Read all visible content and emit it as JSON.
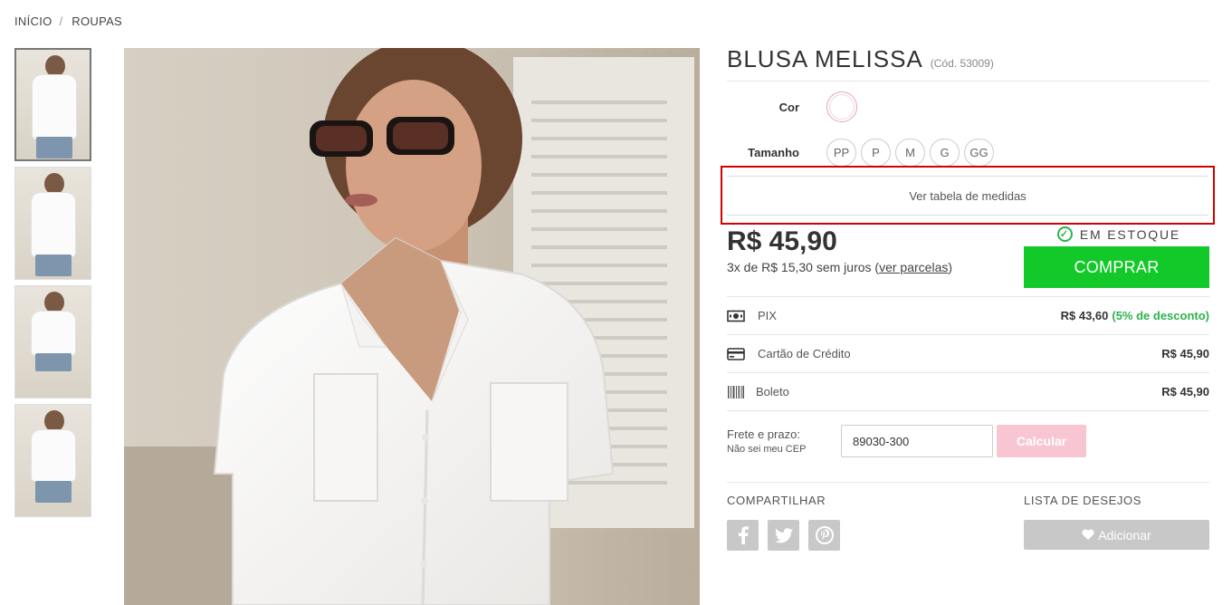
{
  "breadcrumb": {
    "home": "INÍCIO",
    "separator": "/",
    "category": "ROUPAS"
  },
  "thumbnails": [
    {
      "icon": "product-photo-front"
    },
    {
      "icon": "product-photo-back"
    },
    {
      "icon": "product-photo-full-body"
    },
    {
      "icon": "product-photo-knotted"
    }
  ],
  "product": {
    "title": "BLUSA MELISSA",
    "code": "(Cód. 53009)",
    "color_label": "Cor",
    "size_label": "Tamanho",
    "sizes": [
      "PP",
      "P",
      "M",
      "G",
      "GG"
    ],
    "size_table_link": "Ver tabela de medidas",
    "price": "R$ 45,90",
    "installments_text": "3x de R$ 15,30 sem juros (",
    "installments_link": "ver parcelas",
    "installments_close": ")",
    "stock_status": "EM ESTOQUE",
    "buy_label": "COMPRAR"
  },
  "payment": [
    {
      "icon": "pix-icon",
      "name": "PIX",
      "value": "R$ 43,60",
      "discount": "(5% de desconto)"
    },
    {
      "icon": "credit-card-icon",
      "name": "Cartão de Crédito",
      "value": "R$ 45,90",
      "discount": ""
    },
    {
      "icon": "barcode-icon",
      "name": "Boleto",
      "value": "R$ 45,90",
      "discount": ""
    }
  ],
  "shipping": {
    "label": "Frete e prazo:",
    "help_link": "Não sei meu CEP",
    "cep_value": "89030-300",
    "calc_label": "Calcular"
  },
  "share": {
    "label": "COMPARTILHAR",
    "wishlist_label": "LISTA DE DESEJOS",
    "wishlist_button": "Adicionar"
  },
  "colors": {
    "buy_button": "#13c92a",
    "calc_button": "#f8c5d3",
    "in_stock": "#2bb24c",
    "highlight_box": "#d40000"
  }
}
